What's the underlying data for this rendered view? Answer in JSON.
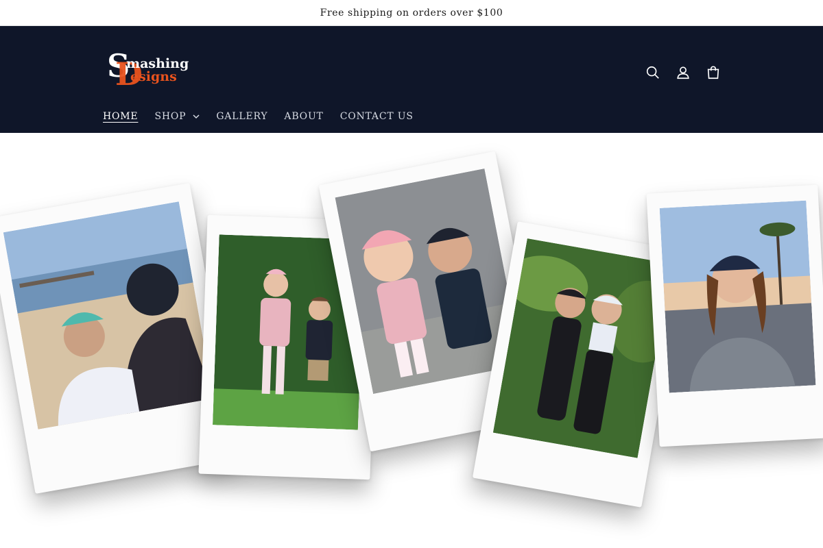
{
  "announcement": {
    "text": "Free shipping on orders over $100"
  },
  "brand": {
    "name_line1": "Smashing",
    "name_line2": "Designs",
    "logo_letters": "SD",
    "colors": {
      "header_bg": "#0f1629",
      "accent": "#e8531e",
      "text_light": "#ffffff"
    }
  },
  "header": {
    "icons": [
      "search-icon",
      "account-icon",
      "cart-icon"
    ]
  },
  "nav": {
    "items": [
      {
        "label": "HOME",
        "active": true
      },
      {
        "label": "SHOP",
        "has_dropdown": true
      },
      {
        "label": "GALLERY"
      },
      {
        "label": "ABOUT"
      },
      {
        "label": "CONTACT US"
      }
    ]
  },
  "hero": {
    "photos": [
      {
        "name": "beach-pier-photo"
      },
      {
        "name": "green-wall-kids-photo"
      },
      {
        "name": "toddlers-couch-photo"
      },
      {
        "name": "friends-tropical-photo"
      },
      {
        "name": "palm-sunset-photo"
      }
    ]
  }
}
